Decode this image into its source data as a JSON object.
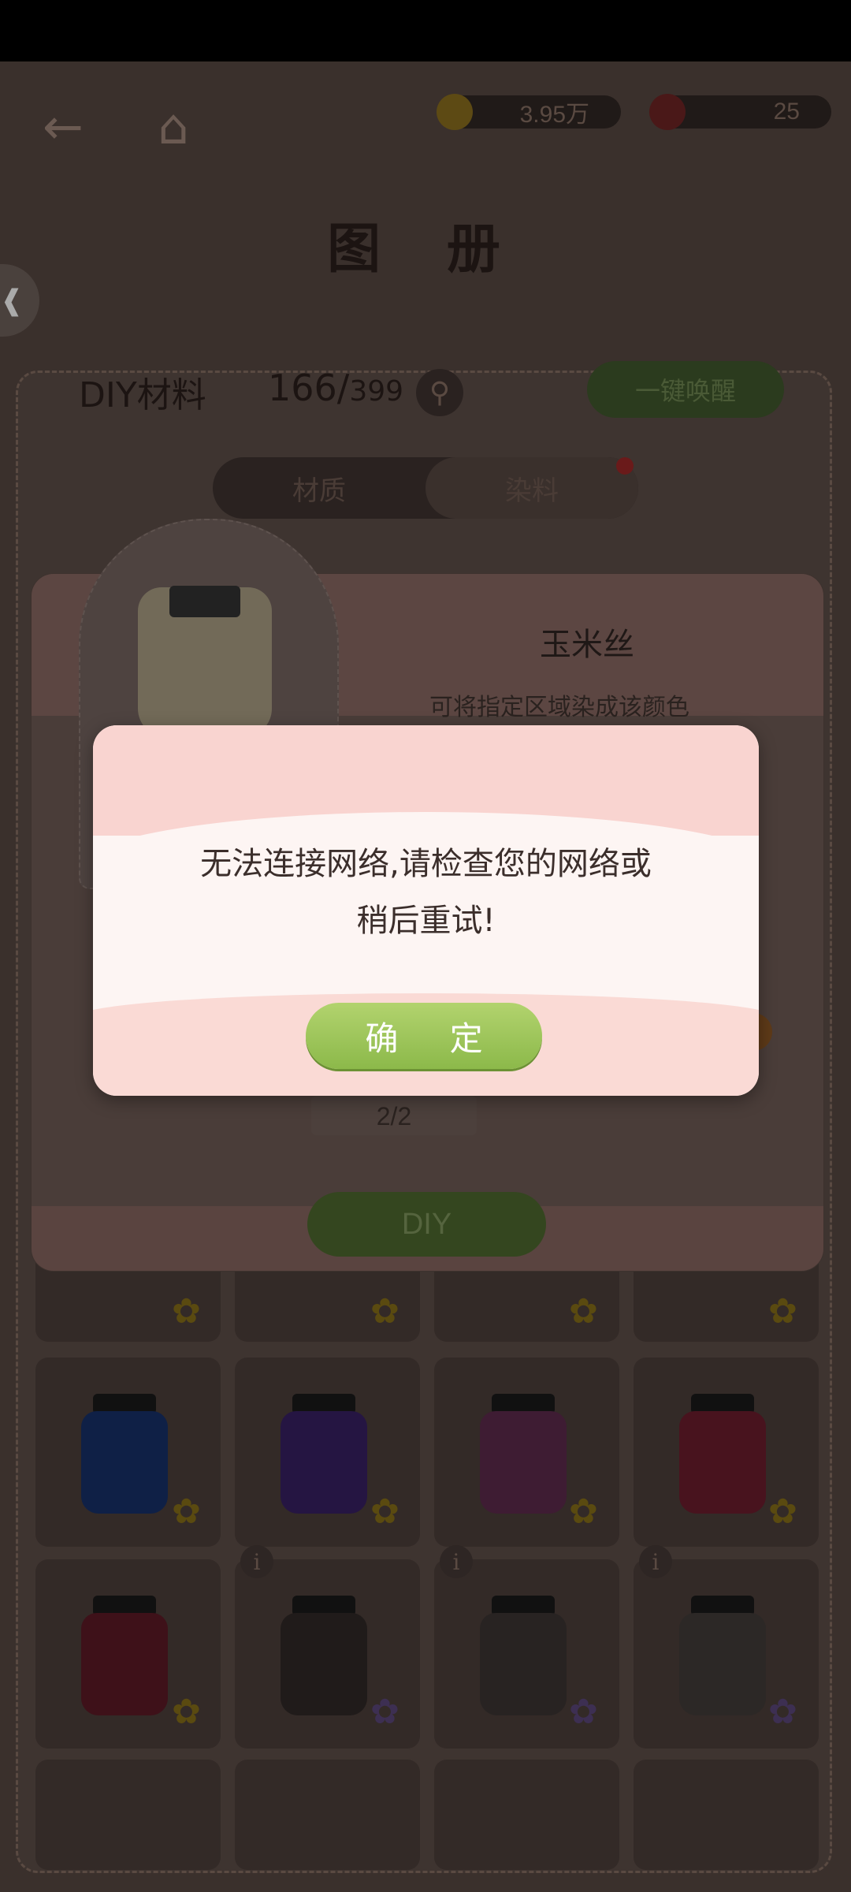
{
  "header": {
    "coins": "3.95万",
    "gems": "25",
    "title": "图 册"
  },
  "collection": {
    "category_label": "DIY材料",
    "progress_current": "166/",
    "progress_total": "399",
    "wake_all_button": "一键唤醒",
    "tabs": [
      {
        "label": "材质",
        "active": false
      },
      {
        "label": "染料",
        "active": true
      }
    ]
  },
  "item_detail": {
    "name": "玉米丝",
    "description": "可将指定区域染成该颜色",
    "count": "2/2",
    "diy_button": "DIY"
  },
  "dialog": {
    "message_line1": "无法连接网络,请检查您的网络或",
    "message_line2": "稍后重试!",
    "confirm_button": "确 定"
  },
  "colors": {
    "dialog_button": "#9cc55a",
    "dialog_top": "#f9d4d0",
    "overlay": "#2a2321"
  }
}
